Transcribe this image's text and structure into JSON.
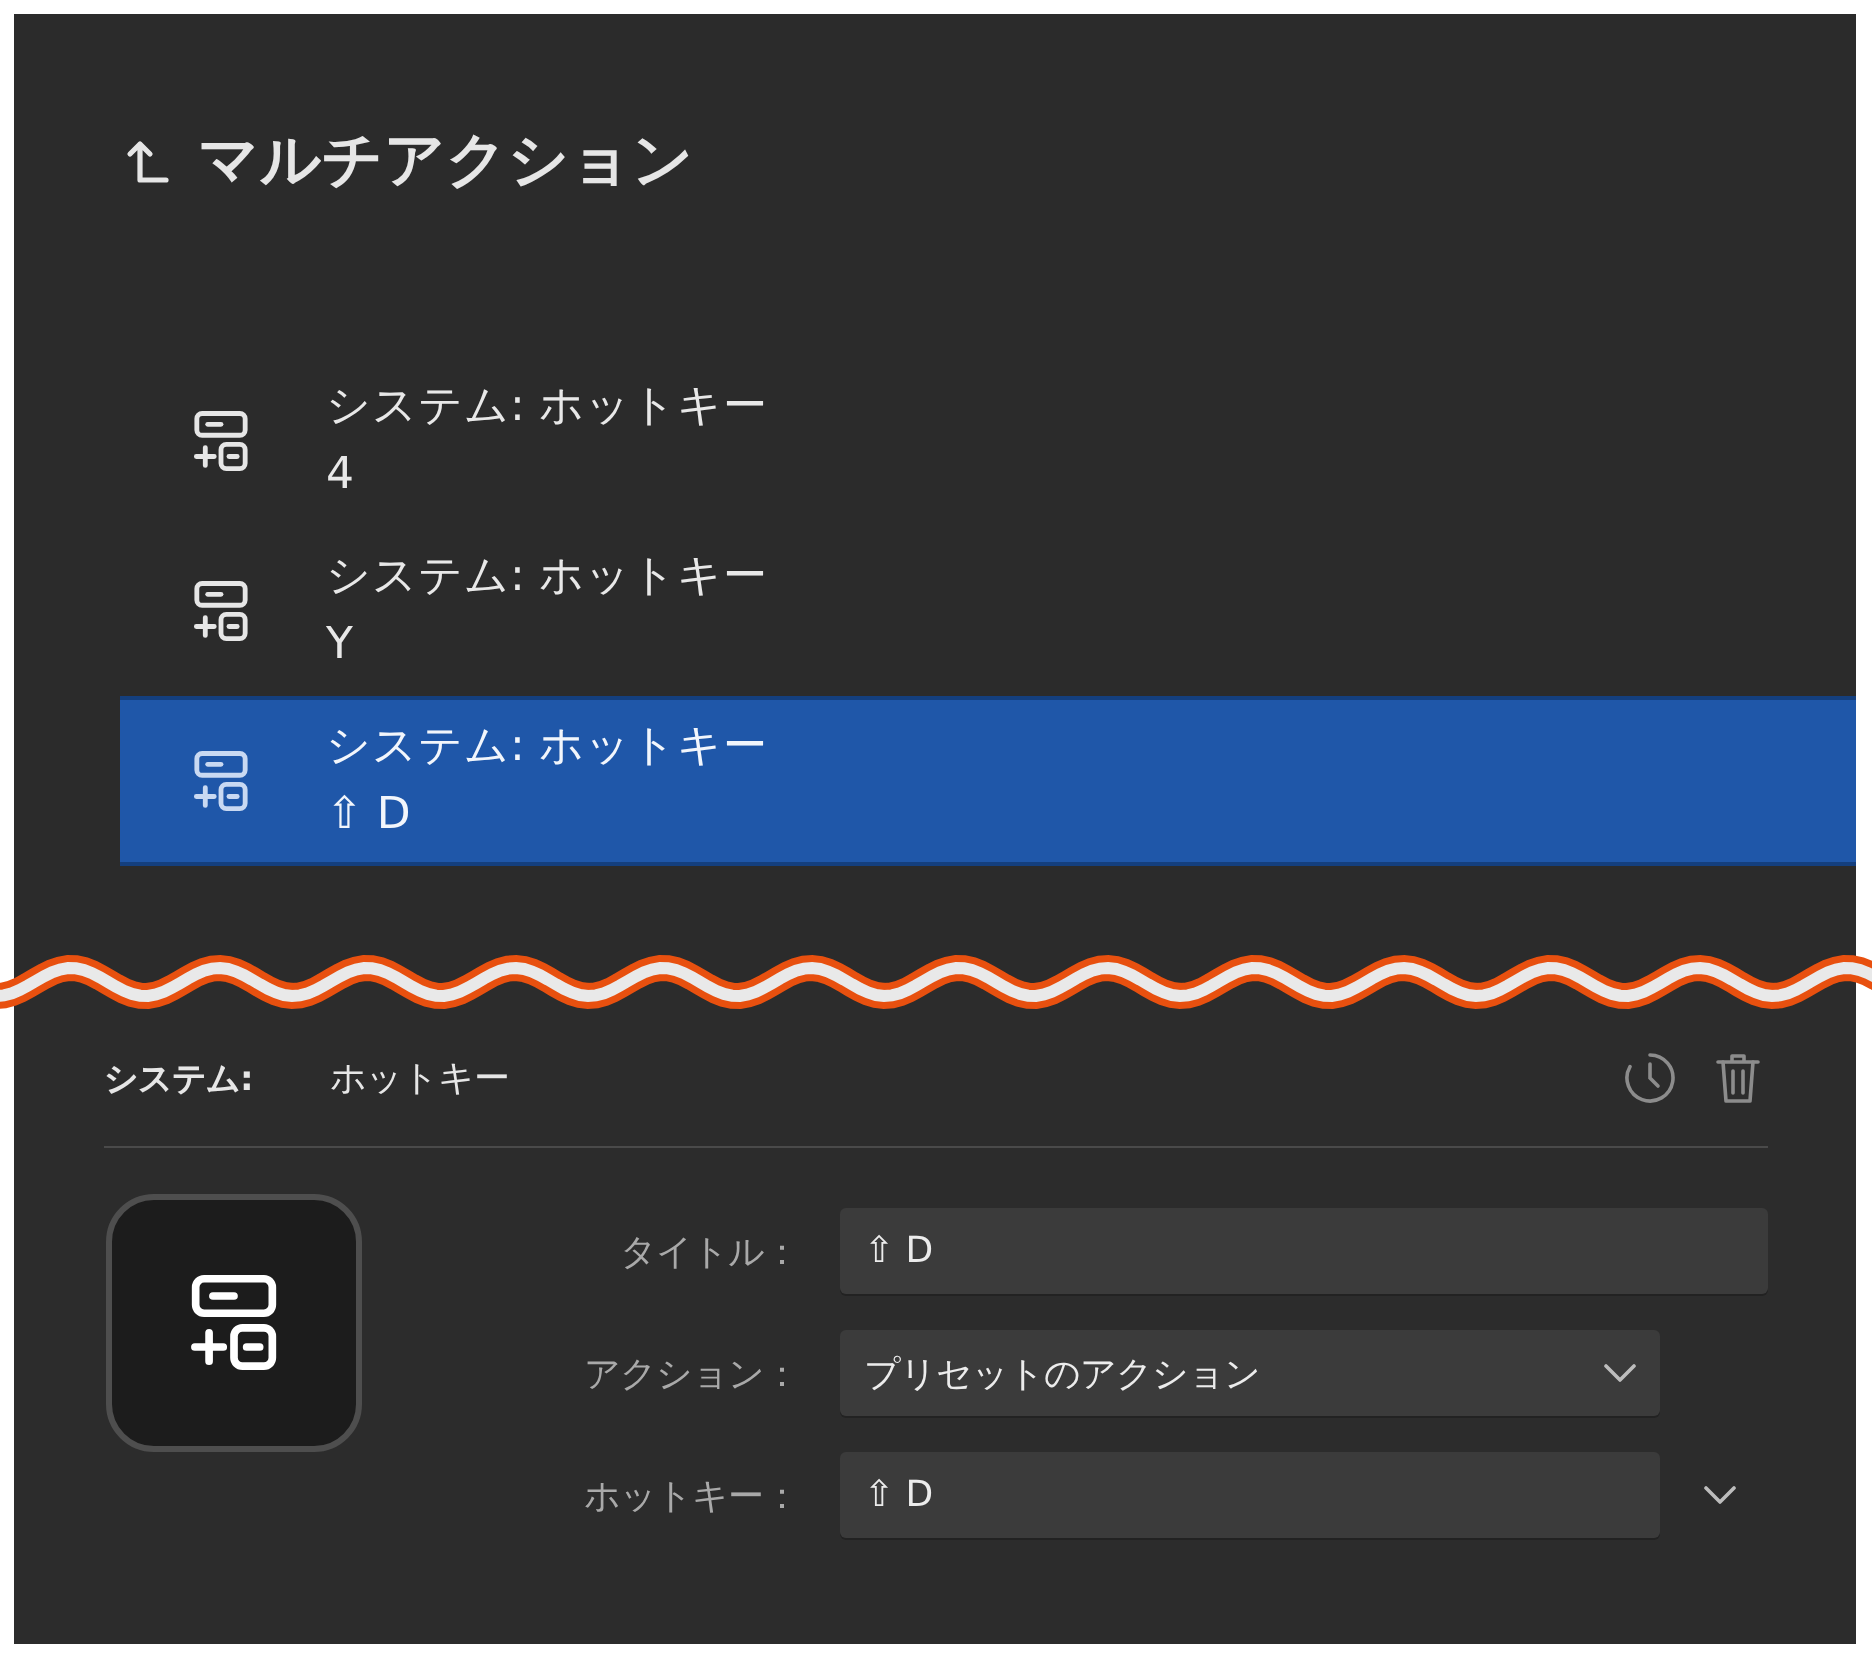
{
  "header": {
    "title": "マルチアクション"
  },
  "actions": [
    {
      "title": "システム: ホットキー",
      "hotkey": "4",
      "selected": false
    },
    {
      "title": "システム: ホットキー",
      "hotkey": "Y",
      "selected": false
    },
    {
      "title": "システム: ホットキー",
      "hotkey": "⇧ D",
      "selected": true
    }
  ],
  "detail": {
    "category": "システム:",
    "name": "ホットキー"
  },
  "fields": [
    {
      "kind": "text",
      "label": "タイトル：",
      "value": "⇧ D"
    },
    {
      "kind": "select",
      "label": "アクション：",
      "value": "プリセットのアクション"
    },
    {
      "kind": "hotkey",
      "label": "ホットキー：",
      "value": "⇧ D"
    }
  ]
}
